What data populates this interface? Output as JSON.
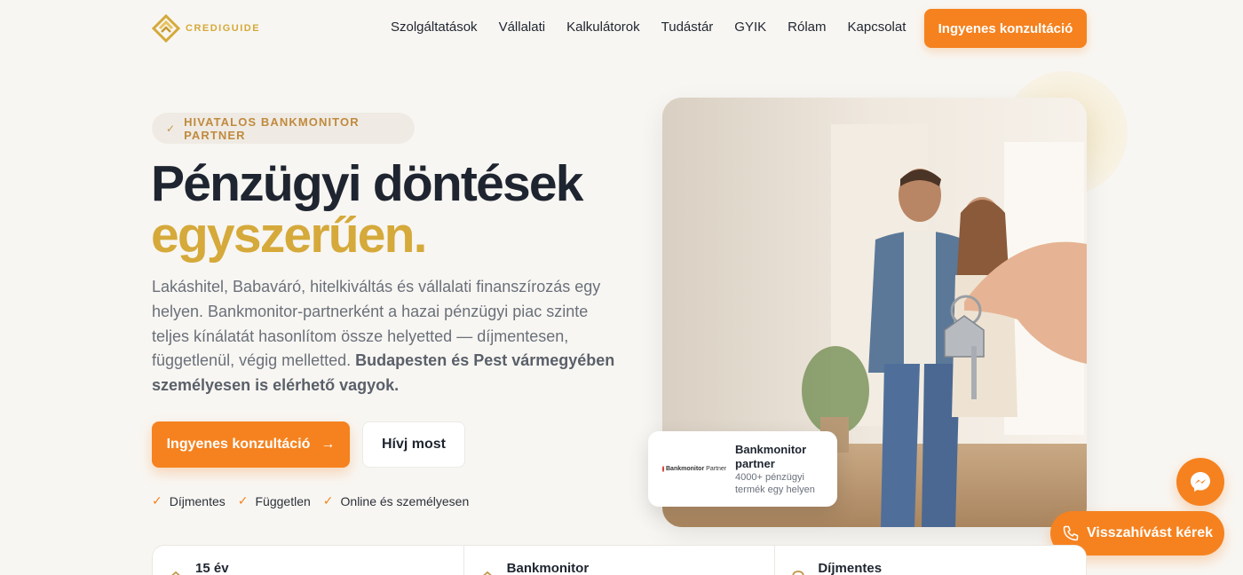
{
  "brand": {
    "name": "CREDIGUIDE"
  },
  "nav": {
    "items": [
      "Szolgáltatások",
      "Vállalati",
      "Kalkulátorok",
      "Tudástár",
      "GYIK",
      "Rólam",
      "Kapcsolat"
    ],
    "cta": "Ingyenes konzultáció"
  },
  "hero": {
    "badge": "HIVATALOS BANKMONITOR PARTNER",
    "headline_line1": "Pénzügyi döntések",
    "headline_line2": "egyszerűen.",
    "lead": "Lakáshitel, Babaváró, hitelkiváltás és vállalati finanszírozás egy helyen. Bankmonitor-partnerként a hazai pénzügyi piac szinte teljes kínálatát hasonlítom össze helyetted — díjmentesen, függetlenül, végig melletted.",
    "lead_bold": "Budapesten és Pest vármegyében személyesen is elérhető vagyok.",
    "primary_button": "Ingyenes konzultáció",
    "primary_arrow": "→",
    "secondary_button": "Hívj most",
    "features": [
      "Díjmentes",
      "Független",
      "Online és személyesen"
    ]
  },
  "partner_card": {
    "logo_text": "Bankmonitor",
    "logo_suffix": "Partner",
    "title": "Bankmonitor partner",
    "subtitle": "4000+ pénzügyi termék egy helyen"
  },
  "floating": {
    "callback": "Visszahívást kérek"
  },
  "stats": [
    {
      "title": "15 év"
    },
    {
      "title": "Bankmonitor"
    },
    {
      "title": "Díjmentes"
    }
  ],
  "colors": {
    "accent": "#f5821f",
    "gold": "#d5a93a",
    "dark": "#1f2530"
  },
  "icons": [
    "check-icon",
    "arrow-right-icon",
    "phone-icon",
    "messenger-icon",
    "house-icon",
    "location-icon"
  ]
}
